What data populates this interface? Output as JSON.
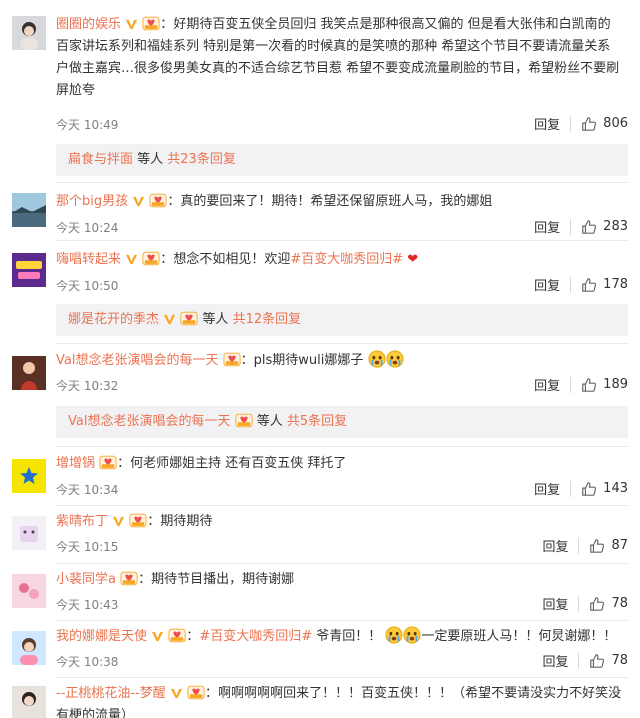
{
  "comments": [
    {
      "user": "圈圈的娱乐",
      "sep": "：",
      "text_lines": [
        "好期待百变五侠全员回归 我笑点是那种很高又偏的 但是看大张伟和白凯南的",
        "百家讲坛系列和福娃系列 特别是第一次看的时候真的是笑喷的那种 希望这个节目不要请流量关系",
        "户做主嘉宾…很多俊男美女真的不适合综艺节目惹 希望不要变成流量刷脸的节目，希望粉丝不要刷",
        "屏尬夸"
      ],
      "time": "今天 10:49",
      "reply": "回复",
      "likes": "806",
      "replies": {
        "user": "扁食与拌面",
        "mid": " 等人 ",
        "count": "共23条回复"
      }
    },
    {
      "user": "那个big男孩",
      "sep": "：",
      "text": "真的要回来了！期待！希望还保留原班人马，我的娜姐",
      "time": "今天 10:24",
      "reply": "回复",
      "likes": "283"
    },
    {
      "user": "嗨唱转起来",
      "sep": "：",
      "text_a": "想念不如相见！欢迎",
      "tag": "#百变大咖秀回归#",
      "heart": "❤",
      "time": "今天 10:50",
      "reply": "回复",
      "likes": "178",
      "replies": {
        "user": "娜是花开的季杰",
        "mid": " 等人 ",
        "count": "共12条回复"
      }
    },
    {
      "user": "Val想念老张演唱会的每一天",
      "sep": "：",
      "text": "pls期待wuli娜娜子",
      "time": "今天 10:32",
      "reply": "回复",
      "likes": "189",
      "replies": {
        "user": "Val想念老张演唱会的每一天",
        "mid": " 等人 ",
        "count": "共5条回复"
      }
    },
    {
      "user": "增增锅",
      "sep": "：",
      "text": "何老师娜姐主持 还有百变五侠 拜托了",
      "time": "今天 10:34",
      "reply": "回复",
      "likes": "143"
    },
    {
      "user": "紫晴布丁",
      "sep": "：",
      "text": "期待期待",
      "time": "今天 10:15",
      "reply": "回复",
      "likes": "87"
    },
    {
      "user": "小裴同学a",
      "sep": "：",
      "text": "期待节目播出，期待谢娜",
      "time": "今天 10:43",
      "reply": "回复",
      "likes": "78"
    },
    {
      "user": "我的娜娜是天使",
      "sep": "：",
      "tag": "#百变大咖秀回归#",
      "text_a": " 爷青回！！",
      "text_b": "一定要原班人马！！何炅谢娜！！",
      "time": "今天 10:38",
      "reply": "回复",
      "likes": "78"
    },
    {
      "user": "--正桃桃花油--梦醒",
      "sep": "：",
      "text_lines": [
        "啊啊啊啊啊回来了！！！百变五侠！！！（希望不要请没实力不好笑没",
        "有梗的流量）"
      ]
    }
  ],
  "colors": {
    "username": "#eb7350",
    "time": "#808080",
    "replybar": "#f2f2f5"
  }
}
